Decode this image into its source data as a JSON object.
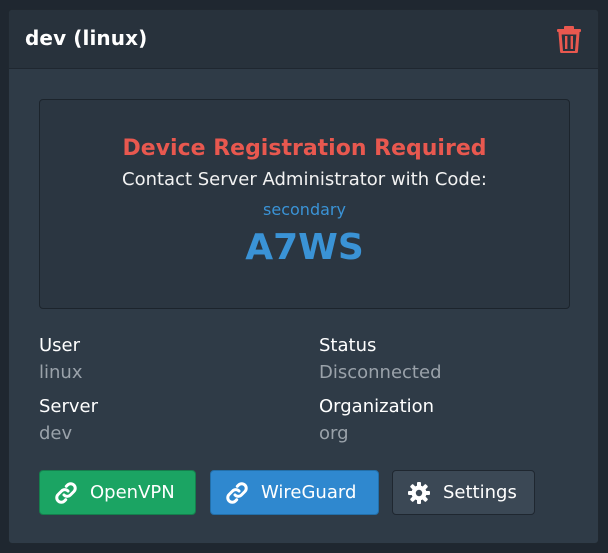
{
  "card": {
    "title": "dev (linux)"
  },
  "registration": {
    "title": "Device Registration Required",
    "subtitle": "Contact Server Administrator with Code:",
    "secondary": "secondary",
    "code": "A7WS"
  },
  "fields": {
    "user_label": "User",
    "user_value": "linux",
    "status_label": "Status",
    "status_value": "Disconnected",
    "server_label": "Server",
    "server_value": "dev",
    "organization_label": "Organization",
    "organization_value": "org"
  },
  "buttons": {
    "openvpn_label": "OpenVPN",
    "wireguard_label": "WireGuard",
    "settings_label": "Settings"
  },
  "icons": {
    "delete": "trash-icon",
    "openvpn": "link-icon",
    "wireguard": "link-icon",
    "settings": "gear-icon"
  },
  "colors": {
    "danger": "#e8584f",
    "accent": "#3a93d6",
    "success_button": "#1ba463",
    "primary_button": "#2f88cf",
    "default_button": "#3b4855"
  }
}
